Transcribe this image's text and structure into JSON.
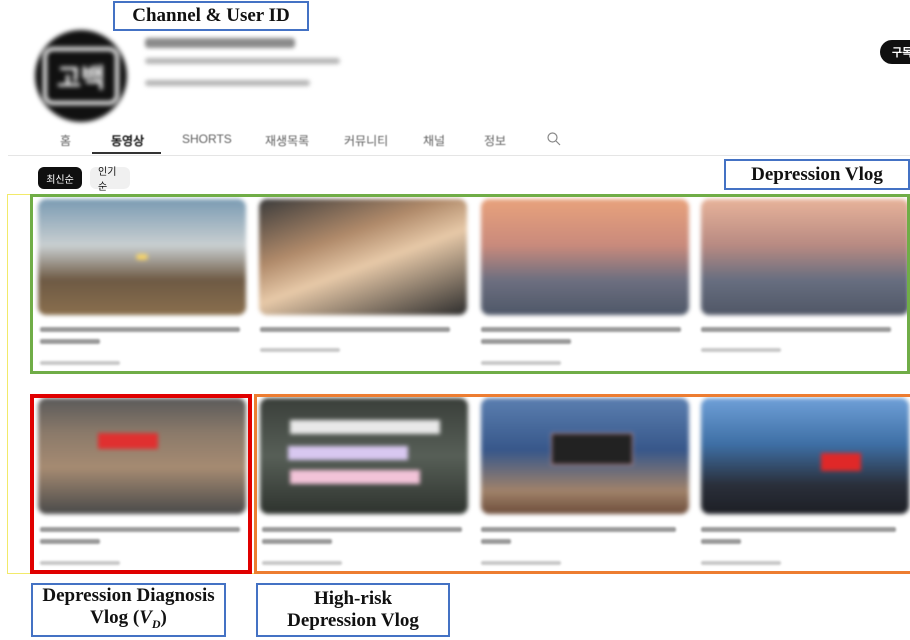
{
  "annotations": {
    "channel_user_id": "Channel & User ID",
    "depression_vlog": "Depression Vlog",
    "diagnosis_line1": "Depression Diagnosis",
    "diagnosis_line2": "Vlog (",
    "diagnosis_var": "V",
    "diagnosis_sub": "D",
    "diagnosis_close": ")",
    "high_risk_line1": "High-risk",
    "high_risk_line2": "Depression Vlog"
  },
  "channel": {
    "avatar_glyph": "고백",
    "subscribe_label": "구독"
  },
  "tabs": [
    "홈",
    "동영상",
    "SHORTS",
    "재생목록",
    "커뮤니티",
    "채널",
    "정보"
  ],
  "search_icon": "search-icon",
  "chips": [
    "최신순",
    "인기순"
  ],
  "colors": {
    "green_frame": "#70ad47",
    "red_frame": "#e00000",
    "orange_frame": "#ed7d31",
    "yellow_frame": "#f2ea6a",
    "label_border": "#4472c4"
  }
}
